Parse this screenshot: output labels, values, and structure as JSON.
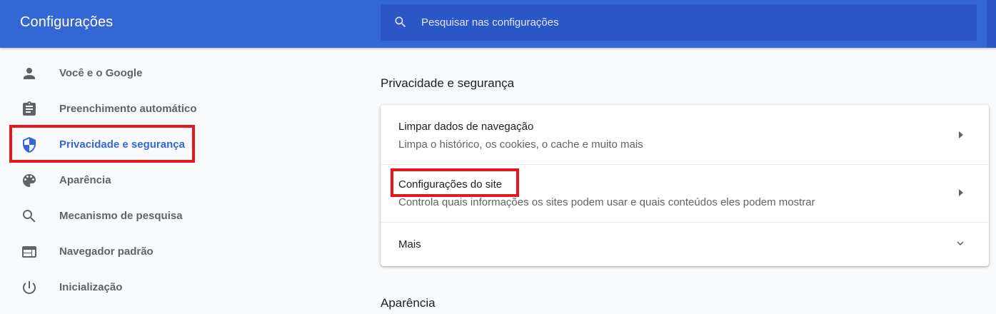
{
  "header": {
    "title": "Configurações",
    "search_placeholder": "Pesquisar nas configurações",
    "search_icon": "search-icon"
  },
  "sidebar": {
    "items": [
      {
        "label": "Você e o Google",
        "icon": "person-icon",
        "active": false
      },
      {
        "label": "Preenchimento automático",
        "icon": "clipboard-icon",
        "active": false
      },
      {
        "label": "Privacidade e segurança",
        "icon": "shield-icon",
        "active": true
      },
      {
        "label": "Aparência",
        "icon": "palette-icon",
        "active": false
      },
      {
        "label": "Mecanismo de pesquisa",
        "icon": "search-icon",
        "active": false
      },
      {
        "label": "Navegador padrão",
        "icon": "browser-window-icon",
        "active": false
      },
      {
        "label": "Inicialização",
        "icon": "power-icon",
        "active": false
      }
    ]
  },
  "main": {
    "section_title": "Privacidade e segurança",
    "rows": [
      {
        "title": "Limpar dados de navegação",
        "subtitle": "Limpa o histórico, os cookies, o cache e muito mais",
        "icon": "arrow-right-icon"
      },
      {
        "title": "Configurações do site",
        "subtitle": "Controla quais informações os sites podem usar e quais conteúdos eles podem mostrar",
        "icon": "arrow-right-icon"
      },
      {
        "title": "Mais",
        "icon": "chevron-down-icon"
      }
    ],
    "next_section_title": "Aparência"
  },
  "colors": {
    "header": "#3367d6",
    "search_bg": "#2a56c6",
    "accent": "#3367d6",
    "highlight": "#e3171e",
    "page_bg": "#f8f9fa"
  }
}
